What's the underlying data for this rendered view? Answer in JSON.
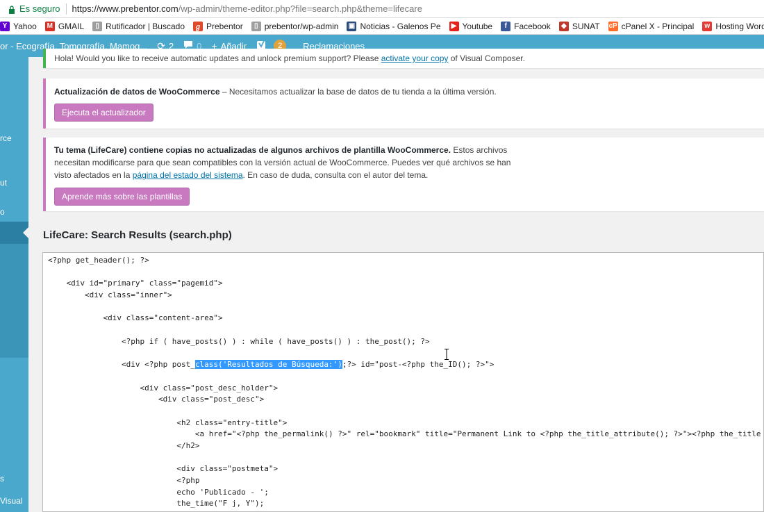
{
  "browser": {
    "secure_label": "Es seguro",
    "url_host": "https://www.prebentor.com",
    "url_path": "/wp-admin/theme-editor.php?file=search.php&theme=lifecare"
  },
  "bookmarks": [
    {
      "label": "Yahoo",
      "icon": "yahoo-icon",
      "color": "#6001d2",
      "glyph": "Y"
    },
    {
      "label": "GMAIL",
      "icon": "gmail-icon",
      "color": "#d93025",
      "glyph": "M"
    },
    {
      "label": "Rutificador | Buscado",
      "icon": "document-icon",
      "color": "#9e9e9e",
      "glyph": "▯"
    },
    {
      "label": "Prebentor",
      "icon": "prebentor-icon",
      "color": "#e0492a",
      "glyph": "ℊ"
    },
    {
      "label": "prebentor/wp-admin",
      "icon": "document-icon",
      "color": "#9e9e9e",
      "glyph": "▯"
    },
    {
      "label": "Noticias - Galenos Pe",
      "icon": "galenos-icon",
      "color": "#2b4c7e",
      "glyph": "▣"
    },
    {
      "label": "Youtube",
      "icon": "youtube-icon",
      "color": "#e62117",
      "glyph": "▶"
    },
    {
      "label": "Facebook",
      "icon": "facebook-icon",
      "color": "#3b5998",
      "glyph": "f"
    },
    {
      "label": "SUNAT",
      "icon": "sunat-icon",
      "color": "#c0392b",
      "glyph": "◆"
    },
    {
      "label": "cPanel X - Principal",
      "icon": "cpanel-icon",
      "color": "#ff6c2c",
      "glyph": "cP"
    },
    {
      "label": "Hosting WordPress",
      "icon": "hosting-icon",
      "color": "#e53935",
      "glyph": "w"
    }
  ],
  "adminbar": {
    "site_name": "or - Ecografía, Tomografía, Mamog...",
    "updates_count": "2",
    "comments_count": "0",
    "add_label": "Añadir",
    "yoast_count": "2",
    "reclamaciones_label": "Reclamaciones"
  },
  "leftmenu": {
    "partial_items": [
      "rce",
      "ut",
      "o",
      "s",
      "Visual"
    ]
  },
  "notices": {
    "vc_text_before": "Hola! Would you like to receive automatic updates and unlock premium support? Please ",
    "vc_link": "activate your copy",
    "vc_text_after": " of Visual Composer.",
    "wc_update_title": "Actualización de datos de WooCommerce",
    "wc_update_text": " – Necesitamos actualizar la base de datos de tu tienda a la última versión.",
    "wc_update_button": "Ejecuta el actualizador",
    "theme_bold": "Tu tema (LifeCare) contiene copias no actualizadas de algunos archivos de plantilla WooCommerce.",
    "theme_text_1": " Estos archivos",
    "theme_text_2": "necesitan modificarse para que sean compatibles con la versión actual de WooCommerce. Puedes ver qué archivos se han",
    "theme_text_3a": "visto afectados en la ",
    "theme_link": "página del estado del sistema",
    "theme_text_3b": ". En caso de duda, consulta con el autor del tema.",
    "theme_button": "Aprende más sobre las plantillas"
  },
  "editor": {
    "title": "LifeCare: Search Results (search.php)",
    "line_1": "<?php get_header(); ?>",
    "line_3": "    <div id=\"primary\" class=\"pagemid\">",
    "line_4": "        <div class=\"inner\">",
    "line_6": "            <div class=\"content-area\">",
    "line_8": "                <?php if ( have_posts() ) : while ( have_posts() ) : the_post(); ?>",
    "line_10_a": "                <div <?php post_",
    "line_10_hl": "class('Resultados de Búsqueda:')",
    "line_10_b": ";?> id=\"post-<?php the_ID(); ?>\">",
    "line_12": "                    <div class=\"post_desc_holder\">",
    "line_13": "                        <div class=\"post_desc\">",
    "line_15": "                            <h2 class=\"entry-title\">",
    "line_16": "                                <a href=\"<?php the_permalink() ?>\" rel=\"bookmark\" title=\"Permanent Link to <?php the_title_attribute(); ?>\"><?php the_title",
    "line_17": "                            </h2>",
    "line_19": "                            <div class=\"postmeta\">",
    "line_20": "                            <?php",
    "line_21": "                            echo 'Publicado - ';",
    "line_22": "                            the_time(\"F j, Y\");"
  }
}
